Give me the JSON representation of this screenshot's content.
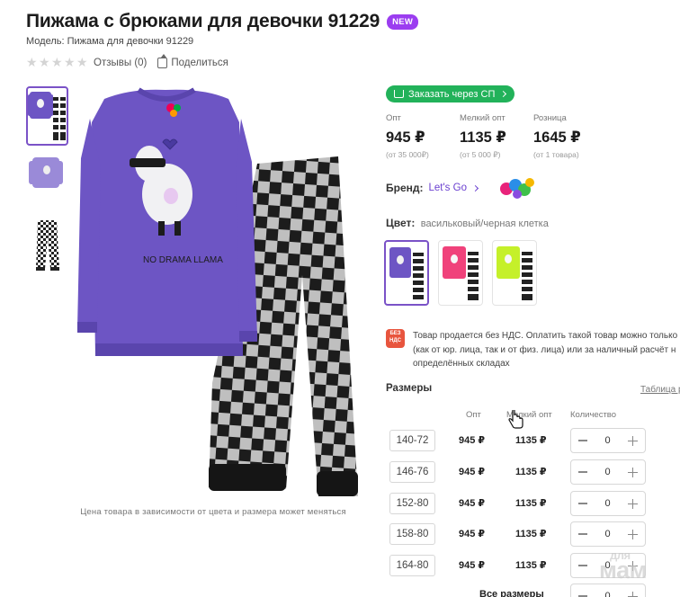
{
  "product": {
    "title": "Пижама с брюками для девочки 91229",
    "badge": "NEW",
    "model": "Модель: Пижама для девочки 91229",
    "reviews": "Отзывы (0)",
    "share": "Поделиться",
    "rating": 0,
    "rating_max": 5,
    "price_note": "Цена товара в зависимости от цвета и размера может меняться"
  },
  "order_button": {
    "label": "Заказать через СП"
  },
  "prices": [
    {
      "label": "Опт",
      "value": "945 ₽",
      "sub": "(от 35 000₽)"
    },
    {
      "label": "Мелкий опт",
      "value": "1135 ₽",
      "sub": "(от 5 000 ₽)"
    },
    {
      "label": "Розница",
      "value": "1645 ₽",
      "sub": "(от 1 товара)"
    }
  ],
  "brand": {
    "label": "Бренд:",
    "name": "Let's Go"
  },
  "color": {
    "label": "Цвет:",
    "value": "васильковый/черная клетка"
  },
  "colors": {
    "violet": "#6d55c4",
    "pink": "#f0427b",
    "lime": "#c5f02a",
    "green": "#22b25a",
    "purple_accent": "#7a52c7"
  },
  "nds": {
    "badge_line1": "БЕЗ",
    "badge_line2": "НДС",
    "line1": "Товар продается без НДС. Оплатить такой товар можно только б",
    "line2": "(как от юр. лица, так и от физ. лица) или за наличный расчёт н",
    "line3": "определённых складах"
  },
  "sizes": {
    "title": "Размеры",
    "table_link": "Таблица р",
    "head_opt": "Опт",
    "head_small": "Мелкий опт",
    "head_qty": "Количество",
    "rows": [
      {
        "size": "140-72",
        "opt": "945 ₽",
        "small": "1135 ₽",
        "qty": "0"
      },
      {
        "size": "146-76",
        "opt": "945 ₽",
        "small": "1135 ₽",
        "qty": "0"
      },
      {
        "size": "152-80",
        "opt": "945 ₽",
        "small": "1135 ₽",
        "qty": "0"
      },
      {
        "size": "158-80",
        "opt": "945 ₽",
        "small": "1135 ₽",
        "qty": "0"
      },
      {
        "size": "164-80",
        "opt": "945 ₽",
        "small": "1135 ₽",
        "qty": "0"
      }
    ],
    "all_label": "Все размеры",
    "all_qty": "0"
  },
  "watermark": {
    "top": "для",
    "bottom": "мам"
  },
  "image_text": "NO DRAMA LLAMA"
}
